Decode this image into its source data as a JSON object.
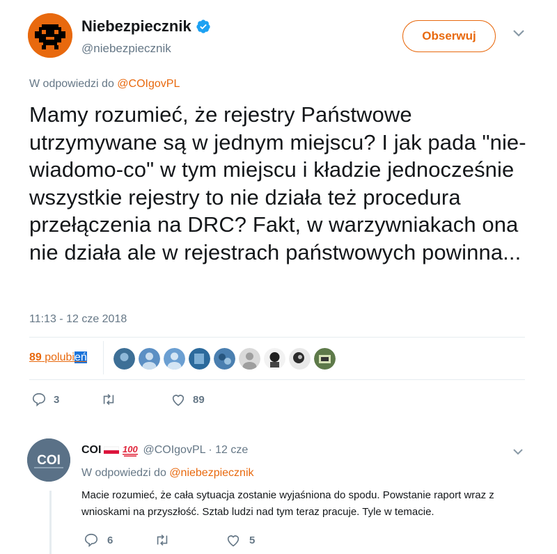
{
  "tweet": {
    "author_name": "Niebezpiecznik",
    "author_handle": "@niebezpiecznik",
    "follow_label": "Obserwuj",
    "reply_prefix": "W odpowiedzi do",
    "reply_to": "@COIgovPL",
    "text": "Mamy rozumieć, że rejestry Państwowe utrzymywane są w jednym miejscu? I jak pada \"nie-wiadomo-co\" w tym miejscu i kładzie jednocześnie wszystkie rejestry to nie działa też procedura przełączenia na DRC? Fakt, w warzywniakach ona nie działa ale w rejestrach państwowych powinna...",
    "timestamp": "11:13 - 12 cze 2018",
    "likes_count": "89",
    "likes_word_a": "polubi",
    "likes_word_b": "eń",
    "replies": "3",
    "retweets": "",
    "likes": "89"
  },
  "reply": {
    "author_name": "COI",
    "handle_date": "@COIgovPL · 12 cze",
    "reply_prefix": "W odpowiedzi do",
    "reply_to": "@niebezpiecznik",
    "text": "Macie rozumieć, że cała sytuacja zostanie wyjaśniona do spodu. Powstanie raport wraz z wnioskami na przyszłość. Sztab ludzi nad tym teraz pracuje. Tyle w temacie.",
    "avatar_text": "COI",
    "replies": "6",
    "retweets": "",
    "likes": "5"
  },
  "colors": {
    "accent": "#e8690e",
    "muted": "#657786",
    "verified": "#1da1f2"
  },
  "icons": {
    "verified": "verified-badge-icon",
    "caret": "chevron-down-icon",
    "reply": "reply-icon",
    "retweet": "retweet-icon",
    "like": "heart-icon"
  }
}
